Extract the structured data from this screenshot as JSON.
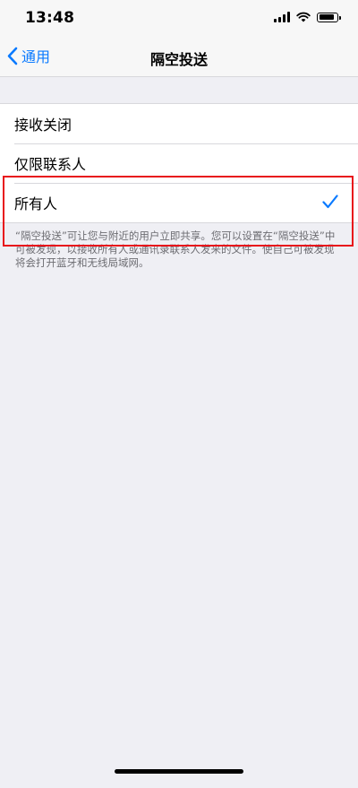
{
  "status_bar": {
    "time": "13:48",
    "icons": [
      "cellular-signal-icon",
      "wifi-icon",
      "battery-icon"
    ]
  },
  "nav": {
    "back_label": "通用",
    "title": "隔空投送"
  },
  "options": [
    {
      "label": "接收关闭",
      "selected": false
    },
    {
      "label": "仅限联系人",
      "selected": false
    },
    {
      "label": "所有人",
      "selected": true
    }
  ],
  "footer_text": "“隔空投送”可让您与附近的用户立即共享。您可以设置在“隔空投送”中可被发现，以接收所有人或通讯录联系人发来的文件。使自己可被发现将会打开蓝牙和无线局域网。",
  "colors": {
    "accent": "#0a7aff",
    "highlight": "#e8141b",
    "background": "#efeff4"
  }
}
